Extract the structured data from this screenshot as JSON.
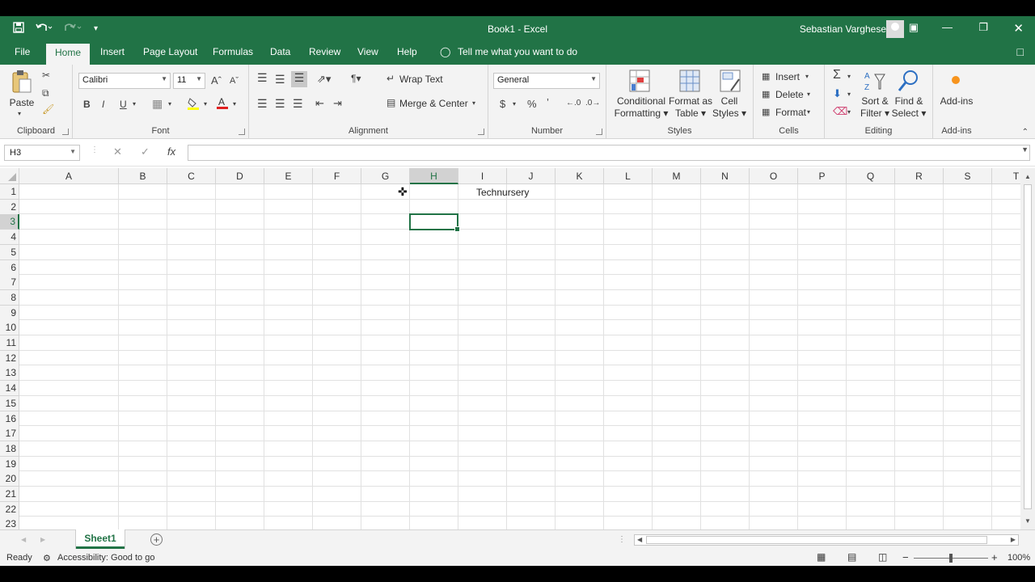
{
  "titlebar": {
    "title": "Book1  -  Excel",
    "user": "Sebastian Varghese",
    "accent": "#217346"
  },
  "qat": {
    "icons": [
      "save-icon",
      "undo-icon",
      "redo-icon",
      "customize-icon"
    ]
  },
  "tabs": [
    "File",
    "Home",
    "Insert",
    "Page Layout",
    "Formulas",
    "Data",
    "Review",
    "View",
    "Help"
  ],
  "tell_me": "Tell me what you want to do",
  "ribbon": {
    "clipboard": {
      "label": "Clipboard",
      "paste": "Paste"
    },
    "font": {
      "label": "Font",
      "name": "Calibri",
      "size": "11",
      "bold": "B",
      "italic": "I",
      "underline": "U"
    },
    "alignment": {
      "label": "Alignment",
      "wrap": "Wrap Text",
      "merge": "Merge & Center"
    },
    "number": {
      "label": "Number",
      "format": "General",
      "currency": "$",
      "percent": "%"
    },
    "styles": {
      "label": "Styles",
      "conditional_1": "Conditional",
      "conditional_2": "Formatting",
      "format_table_1": "Format as",
      "format_table_2": "Table",
      "cell_styles_1": "Cell",
      "cell_styles_2": "Styles"
    },
    "cells": {
      "label": "Cells",
      "insert": "Insert",
      "delete": "Delete",
      "format": "Format"
    },
    "editing": {
      "label": "Editing",
      "sort_1": "Sort &",
      "sort_2": "Filter",
      "find_1": "Find &",
      "find_2": "Select"
    },
    "addins": {
      "label": "Add-ins",
      "button": "Add-ins"
    }
  },
  "formula_bar": {
    "name_box": "H3",
    "fx": "fx",
    "value": ""
  },
  "grid": {
    "columns": [
      "A",
      "B",
      "C",
      "D",
      "E",
      "F",
      "G",
      "H",
      "I",
      "J",
      "K",
      "L",
      "M",
      "N",
      "O",
      "P",
      "Q",
      "R",
      "S",
      "T"
    ],
    "rows": [
      "1",
      "2",
      "3",
      "4",
      "5",
      "6",
      "7",
      "8",
      "9",
      "10",
      "11",
      "12",
      "13",
      "14",
      "15",
      "16",
      "17",
      "18",
      "19",
      "20",
      "21",
      "22",
      "23"
    ],
    "selected_column": "H",
    "selected_row": "3",
    "cell_I1": "Technursery"
  },
  "sheets": {
    "active": "Sheet1"
  },
  "status": {
    "ready": "Ready",
    "accessibility": "Accessibility: Good to go",
    "zoom": "100%"
  }
}
